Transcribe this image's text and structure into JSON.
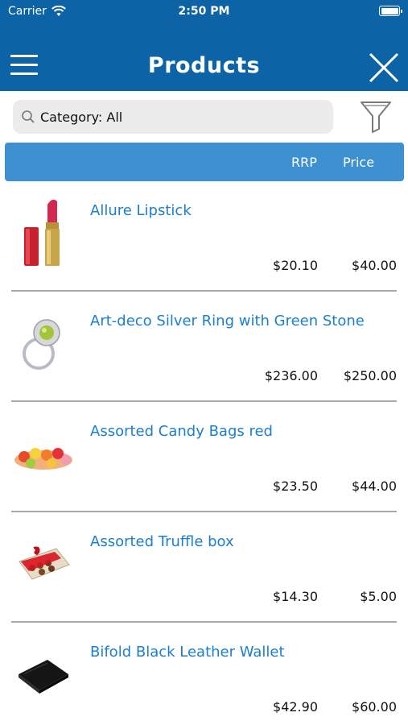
{
  "status_bar": {
    "carrier": "Carrier",
    "time": "2:50 PM"
  },
  "nav": {
    "title": "Products"
  },
  "search": {
    "value": "Category: All"
  },
  "table_header": {
    "rrp": "RRP",
    "price": "Price"
  },
  "products": [
    {
      "name": "Allure Lipstick",
      "rrp": "$20.10",
      "price": "$40.00",
      "thumb": "lipstick"
    },
    {
      "name": "Art-deco Silver Ring with Green Stone",
      "rrp": "$236.00",
      "price": "$250.00",
      "thumb": "ring"
    },
    {
      "name": "Assorted Candy Bags red",
      "rrp": "$23.50",
      "price": "$44.00",
      "thumb": "candy"
    },
    {
      "name": "Assorted Truffle box",
      "rrp": "$14.30",
      "price": "$5.00",
      "thumb": "truffle-box"
    },
    {
      "name": "Bifold Black Leather Wallet",
      "rrp": "$42.90",
      "price": "$60.00",
      "thumb": "wallet"
    }
  ],
  "colors": {
    "nav_bg": "#0c63a6",
    "header_bg": "#3d91d1",
    "link": "#1a7fd1"
  }
}
